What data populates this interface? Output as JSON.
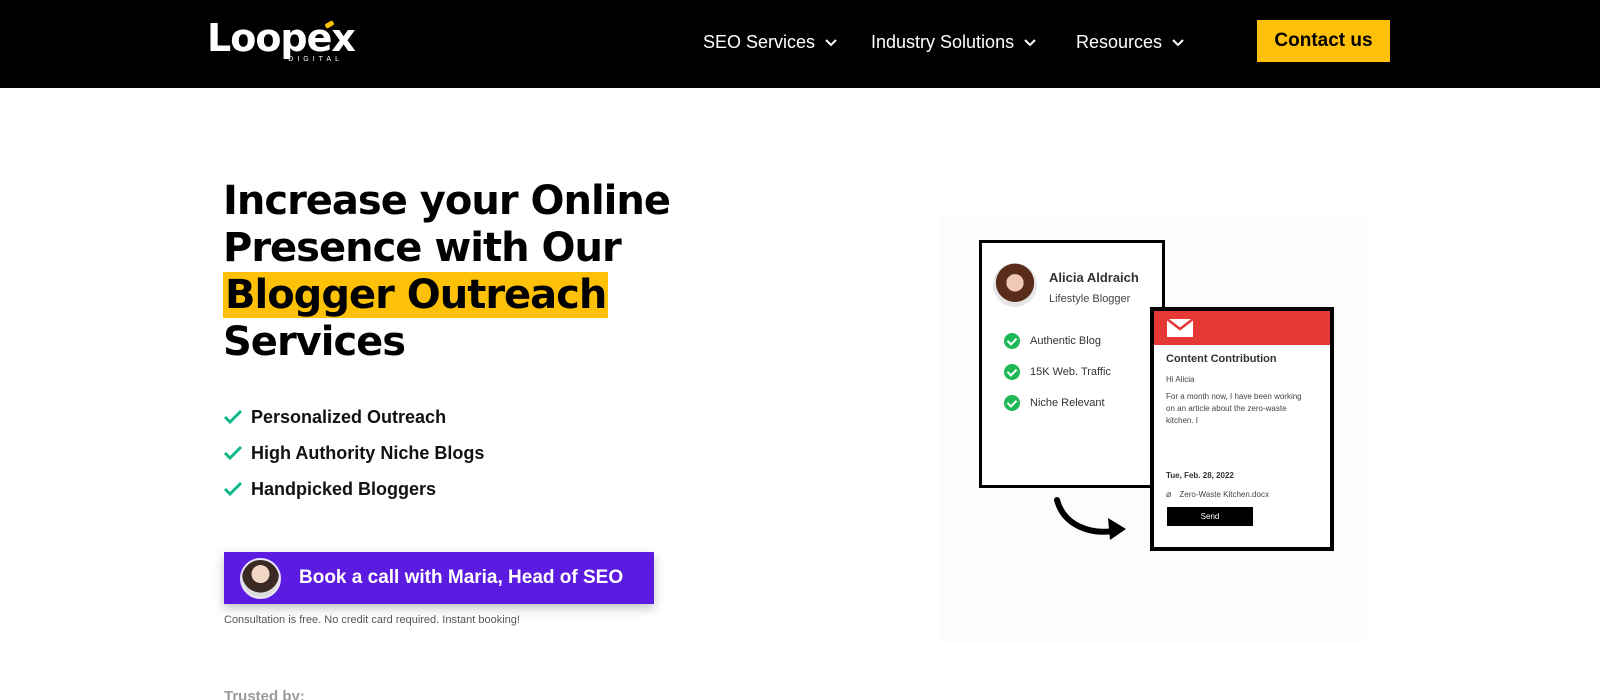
{
  "header": {
    "logo_text": "Loopex",
    "logo_subtext": "DIGITAL",
    "nav": [
      {
        "label": "SEO Services",
        "icon": "chevron-down-icon"
      },
      {
        "label": "Industry Solutions",
        "icon": "chevron-down-icon"
      },
      {
        "label": "Resources",
        "icon": "chevron-down-icon"
      }
    ],
    "contact_label": "Contact us"
  },
  "hero": {
    "title_line1": "Increase your Online",
    "title_line2": "Presence with Our",
    "title_highlight": "Blogger Outreach",
    "title_line4": "Services",
    "features": [
      "Personalized Outreach",
      "High Authority Niche Blogs",
      "Handpicked Bloggers"
    ],
    "cta_label": "Book a call with Maria, Head of SEO",
    "cta_note": "Consultation is free. No credit card required. Instant booking!",
    "trusted_label": "Trusted by:"
  },
  "illustration": {
    "profile": {
      "name": "Alicia Aldraich",
      "role": "Lifestyle Blogger",
      "items": [
        "Authentic Blog",
        "15K Web. Traffic",
        "Niche Relevant"
      ]
    },
    "email": {
      "title": "Content Contribution",
      "greeting": "Hi Alicia",
      "body": "For a month now, I have been working on an article about the zero-waste kitchen. I",
      "date": "Tue, Feb. 28, 2022",
      "attachment": "Zero-Waste Kitchen.docx",
      "send_label": "Send"
    }
  },
  "colors": {
    "accent_yellow": "#FFC107",
    "cta_purple": "#5B1BE0",
    "check_green": "#1DB954",
    "email_red": "#E53935"
  }
}
